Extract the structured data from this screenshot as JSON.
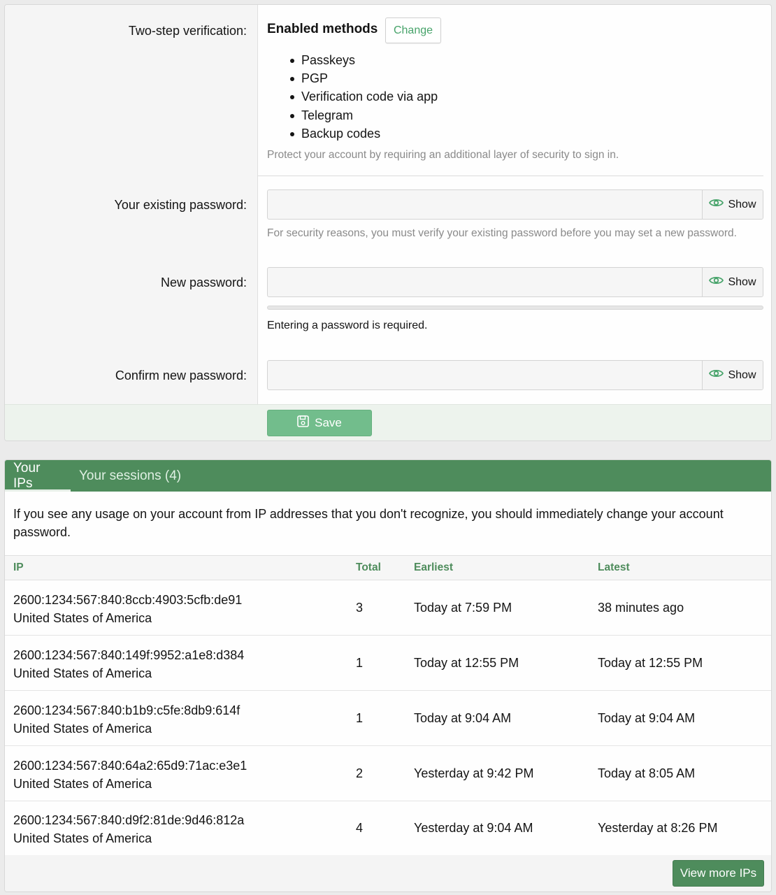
{
  "security": {
    "two_step_label": "Two-step verification:",
    "enabled_title": "Enabled methods",
    "change_label": "Change",
    "methods": [
      "Passkeys",
      "PGP",
      "Verification code via app",
      "Telegram",
      "Backup codes"
    ],
    "two_step_hint": "Protect your account by requiring an additional layer of security to sign in."
  },
  "password": {
    "existing_label": "Your existing password:",
    "existing_hint": "For security reasons, you must verify your existing password before you may set a new password.",
    "new_label": "New password:",
    "strength_fraction": 0,
    "required_text": "Entering a password is required.",
    "confirm_label": "Confirm new password:",
    "show_label": "Show",
    "existing_value": "",
    "new_value": "",
    "confirm_value": ""
  },
  "save_label": "Save",
  "tabs": {
    "ips": "Your IPs",
    "sessions": "Your sessions (4)"
  },
  "ip_notice": "If you see any usage on your account from IP addresses that you don't recognize, you should immediately change your account password.",
  "table": {
    "headers": {
      "ip": "IP",
      "total": "Total",
      "earliest": "Earliest",
      "latest": "Latest"
    },
    "rows": [
      {
        "ip": "2600:1234:567:840:8ccb:4903:5cfb:de91",
        "country": "United States of America",
        "total": "3",
        "earliest": "Today at 7:59 PM",
        "latest": "38 minutes ago"
      },
      {
        "ip": "2600:1234:567:840:149f:9952:a1e8:d384",
        "country": "United States of America",
        "total": "1",
        "earliest": "Today at 12:55 PM",
        "latest": "Today at 12:55 PM"
      },
      {
        "ip": "2600:1234:567:840:b1b9:c5fe:8db9:614f",
        "country": "United States of America",
        "total": "1",
        "earliest": "Today at 9:04 AM",
        "latest": "Today at 9:04 AM"
      },
      {
        "ip": "2600:1234:567:840:64a2:65d9:71ac:e3e1",
        "country": "United States of America",
        "total": "2",
        "earliest": "Yesterday at 9:42 PM",
        "latest": "Today at 8:05 AM"
      },
      {
        "ip": "2600:1234:567:840:d9f2:81de:9d46:812a",
        "country": "United States of America",
        "total": "4",
        "earliest": "Yesterday at 9:04 AM",
        "latest": "Yesterday at 8:26 PM"
      }
    ]
  },
  "view_more_label": "View more IPs",
  "colors": {
    "brand_green": "#4e8c5c",
    "accent_green": "#47a36a",
    "save_green": "#72bd8c"
  },
  "icons": {
    "show": "eye-icon",
    "save": "floppy-disk-icon"
  }
}
